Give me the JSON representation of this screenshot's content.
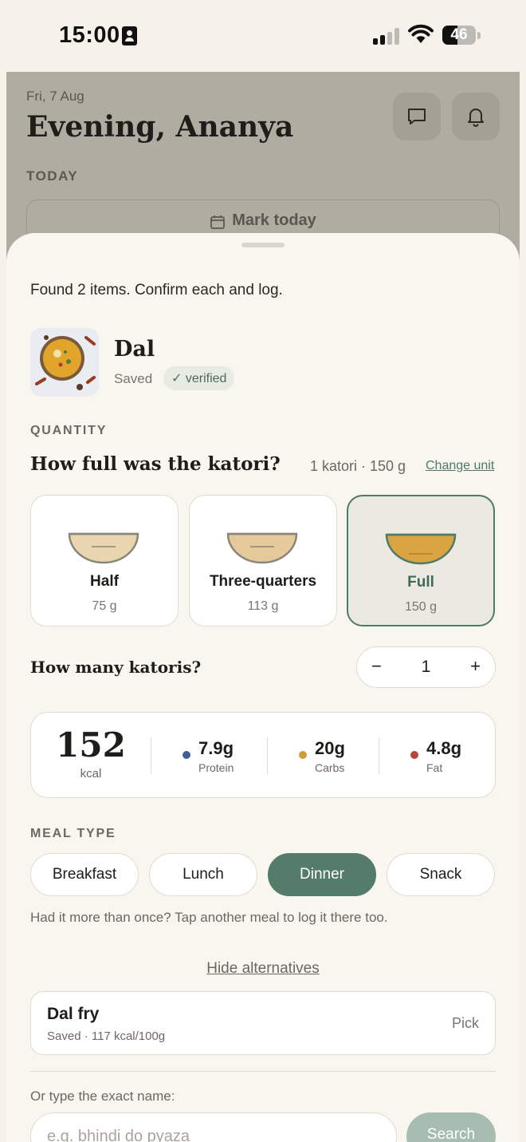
{
  "status_bar": {
    "time": "15:00",
    "battery": "46",
    "battery_level": 0.46
  },
  "background_screen": {
    "date": "Fri, 7 Aug",
    "greeting": "Evening, Ananya",
    "section": "TODAY",
    "mark_today": "Mark today",
    "icons": [
      "chat-icon",
      "bell-icon"
    ]
  },
  "sheet": {
    "found_text": "Found 2 items. Confirm each and log.",
    "food": {
      "name": "Dal",
      "source": "Saved",
      "badge": "✓ verified"
    },
    "quantity": {
      "label": "QUANTITY",
      "question": "How full was the katori?",
      "unit_info": "1 katori · 150 g",
      "change_unit": "Change unit",
      "options": [
        {
          "label": "Half",
          "grams": "75 g",
          "fill": 0.5,
          "selected": false
        },
        {
          "label": "Three-quarters",
          "grams": "113 g",
          "fill": 0.75,
          "selected": false
        },
        {
          "label": "Full",
          "grams": "150 g",
          "fill": 1.0,
          "selected": true
        }
      ]
    },
    "count": {
      "question": "How many katoris?",
      "minus": "−",
      "value": "1",
      "plus": "+"
    },
    "nutrition": {
      "kcal": "152",
      "kcal_label": "kcal",
      "macros": [
        {
          "value": "7.9g",
          "label": "Protein",
          "color": "#3f5e93"
        },
        {
          "value": "20g",
          "label": "Carbs",
          "color": "#d19b3a"
        },
        {
          "value": "4.8g",
          "label": "Fat",
          "color": "#b5473d"
        }
      ]
    },
    "meal_type": {
      "label": "MEAL TYPE",
      "options": [
        "Breakfast",
        "Lunch",
        "Dinner",
        "Snack"
      ],
      "selected": "Dinner",
      "hint": "Had it more than once? Tap another meal to log it there too."
    },
    "alternatives": {
      "toggle": "Hide alternatives",
      "items": [
        {
          "name": "Dal fry",
          "meta": "Saved · 117 kcal/100g",
          "action": "Pick"
        }
      ]
    },
    "manual": {
      "label": "Or type the exact name:",
      "placeholder": "e.g. bhindi do pyaza",
      "button": "Search"
    }
  },
  "colors": {
    "accent": "#557b6b",
    "background": "#f6f2ea",
    "sheet": "#f9f6ef",
    "dal_fill": "#d9a441"
  }
}
